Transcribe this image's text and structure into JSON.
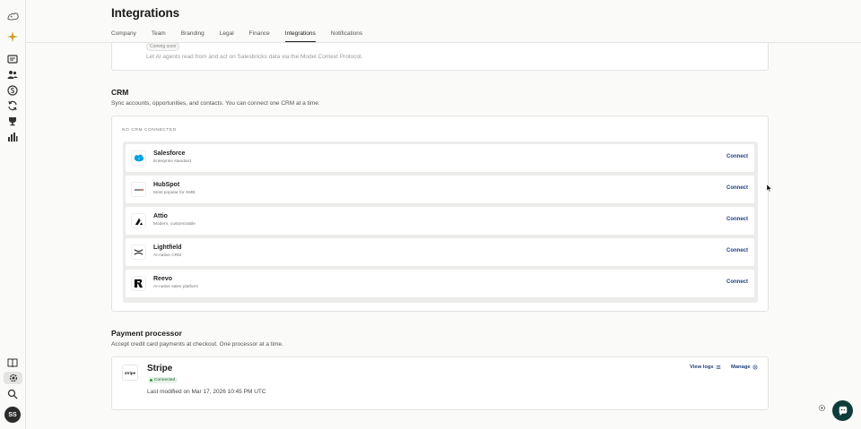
{
  "sidebar": {
    "items": [
      {
        "icon": "logo-icon"
      },
      {
        "icon": "sparkle-icon"
      },
      {
        "icon": "inbox-icon"
      },
      {
        "icon": "users-icon"
      },
      {
        "icon": "dollar-icon"
      },
      {
        "icon": "refresh-icon"
      },
      {
        "icon": "trophy-icon"
      },
      {
        "icon": "bar-chart-icon"
      },
      {
        "icon": "book-icon"
      },
      {
        "icon": "settings-icon"
      },
      {
        "icon": "search-icon"
      }
    ],
    "avatar_initials": "SS"
  },
  "header": {
    "title": "Integrations",
    "tabs": [
      {
        "label": "Company"
      },
      {
        "label": "Team"
      },
      {
        "label": "Branding"
      },
      {
        "label": "Legal"
      },
      {
        "label": "Finance"
      },
      {
        "label": "Integrations",
        "active": true
      },
      {
        "label": "Notifications"
      }
    ]
  },
  "mcp": {
    "badge": "Coming soon",
    "description": "Let AI agents read from and act on Salesbricks data via the Model Context Protocol."
  },
  "crm": {
    "title": "CRM",
    "description": "Sync accounts, opportunities, and contacts. You can connect one CRM at a time.",
    "status_label": "NO CRM CONNECTED",
    "providers": [
      {
        "name": "Salesforce",
        "subtitle": "Enterprise standard",
        "action": "Connect",
        "logo": "salesforce-logo-icon",
        "color": "#00a1e0"
      },
      {
        "name": "HubSpot",
        "subtitle": "Most popular for SMB",
        "action": "Connect",
        "logo": "hubspot-logo-icon",
        "color": "#ff7a59"
      },
      {
        "name": "Attio",
        "subtitle": "Modern, customizable",
        "action": "Connect",
        "logo": "attio-logo-icon",
        "color": "#111111"
      },
      {
        "name": "Lightfield",
        "subtitle": "AI-native CRM",
        "action": "Connect",
        "logo": "lightfield-logo-icon",
        "color": "#222222"
      },
      {
        "name": "Reevo",
        "subtitle": "AI-native sales platform",
        "action": "Connect",
        "logo": "reevo-logo-icon",
        "color": "#111111"
      }
    ]
  },
  "payment": {
    "title": "Payment processor",
    "description": "Accept credit card payments at checkout. One processor at a time.",
    "provider": {
      "logo_text": "stripe",
      "name": "Stripe",
      "status": "Connected",
      "last_modified": "Last modified on Mar 17, 2026 10:45 PM UTC",
      "view_logs": "View logs",
      "manage": "Manage"
    }
  },
  "colors": {
    "accent": "#1f3f7a",
    "chat": "#0f3d3a",
    "connected": "#28a745"
  }
}
